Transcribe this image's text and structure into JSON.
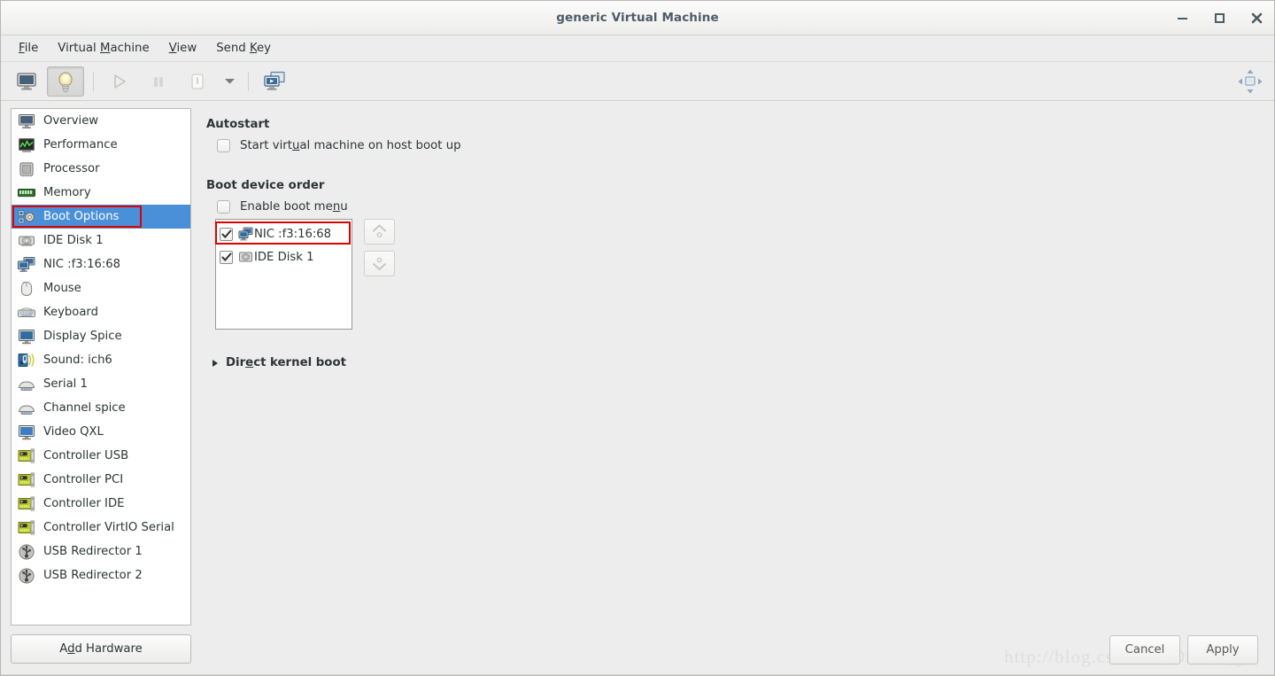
{
  "window": {
    "title": "generic Virtual Machine",
    "controls": [
      {
        "name": "minimize",
        "glyph": "_"
      },
      {
        "name": "maximize",
        "glyph": "□"
      },
      {
        "name": "close",
        "glyph": "✕"
      }
    ]
  },
  "menubar": {
    "items": [
      {
        "label": "File",
        "accel_index": 0
      },
      {
        "label": "Virtual Machine",
        "accel_index": 8
      },
      {
        "label": "View",
        "accel_index": 0
      },
      {
        "label": "Send Key",
        "accel_index": 5
      }
    ]
  },
  "toolbar": {
    "buttons": [
      {
        "name": "console-view-button",
        "icon": "monitor-icon",
        "state": "normal"
      },
      {
        "name": "details-view-button",
        "icon": "lightbulb-icon",
        "state": "pressed"
      },
      {
        "name": "run-button",
        "icon": "play-icon",
        "state": "disabled"
      },
      {
        "name": "pause-button",
        "icon": "pause-icon",
        "state": "disabled"
      },
      {
        "name": "shutdown-button",
        "icon": "power-icon",
        "state": "disabled"
      },
      {
        "name": "shutdown-menu-button",
        "icon": "chevron-down-icon",
        "state": "normal"
      },
      {
        "name": "snapshots-button",
        "icon": "snapshots-icon",
        "state": "normal"
      }
    ],
    "right_button": {
      "name": "resize-to-vm-button",
      "icon": "resize-arrows-icon"
    }
  },
  "sidebar": {
    "selected_index": 4,
    "items": [
      {
        "label": "Overview",
        "icon": "monitor-icon"
      },
      {
        "label": "Performance",
        "icon": "chart-icon"
      },
      {
        "label": "Processor",
        "icon": "cpu-icon"
      },
      {
        "label": "Memory",
        "icon": "memory-icon"
      },
      {
        "label": "Boot Options",
        "icon": "boot-options-icon"
      },
      {
        "label": "IDE Disk 1",
        "icon": "disk-icon"
      },
      {
        "label": "NIC :f3:16:68",
        "icon": "network-icon"
      },
      {
        "label": "Mouse",
        "icon": "mouse-icon"
      },
      {
        "label": "Keyboard",
        "icon": "keyboard-icon"
      },
      {
        "label": "Display Spice",
        "icon": "display-icon"
      },
      {
        "label": "Sound: ich6",
        "icon": "sound-icon"
      },
      {
        "label": "Serial 1",
        "icon": "serial-icon"
      },
      {
        "label": "Channel spice",
        "icon": "serial-icon"
      },
      {
        "label": "Video QXL",
        "icon": "video-icon"
      },
      {
        "label": "Controller USB",
        "icon": "controller-icon"
      },
      {
        "label": "Controller PCI",
        "icon": "controller-icon"
      },
      {
        "label": "Controller IDE",
        "icon": "controller-icon"
      },
      {
        "label": "Controller VirtIO Serial",
        "icon": "controller-icon"
      },
      {
        "label": "USB Redirector 1",
        "icon": "usb-icon"
      },
      {
        "label": "USB Redirector 2",
        "icon": "usb-icon"
      }
    ],
    "add_hardware_label": "Add Hardware",
    "add_hardware_accel_index": 1
  },
  "main": {
    "autostart": {
      "title": "Autostart",
      "checkbox_label": "Start virtual machine on host boot up",
      "checkbox_accel_index": 12,
      "checked": false
    },
    "boot_order": {
      "title": "Boot device order",
      "enable_menu_label": "Enable boot menu",
      "enable_menu_accel_index": 14,
      "enable_menu_checked": false,
      "devices": [
        {
          "label": "NIC :f3:16:68",
          "icon": "network-icon",
          "checked": true,
          "selected": true
        },
        {
          "label": "IDE Disk 1",
          "icon": "disk-icon",
          "checked": true,
          "selected": false
        }
      ],
      "move_up_button": {
        "name": "move-up-button",
        "enabled": false
      },
      "move_down_button": {
        "name": "move-down-button",
        "enabled": false
      }
    },
    "direct_kernel_boot": {
      "label": "Direct kernel boot",
      "accel_index": 3,
      "expanded": false
    }
  },
  "footer": {
    "cancel_label": "Cancel",
    "apply_label": "Apply"
  },
  "watermark": {
    "text": "http://blog.csdn.net/Dream_ya"
  },
  "colors": {
    "selection_blue": "#4a90d9",
    "annotation_red": "#e00000",
    "window_bg": "#ededed",
    "title_text": "#4d5b66"
  }
}
